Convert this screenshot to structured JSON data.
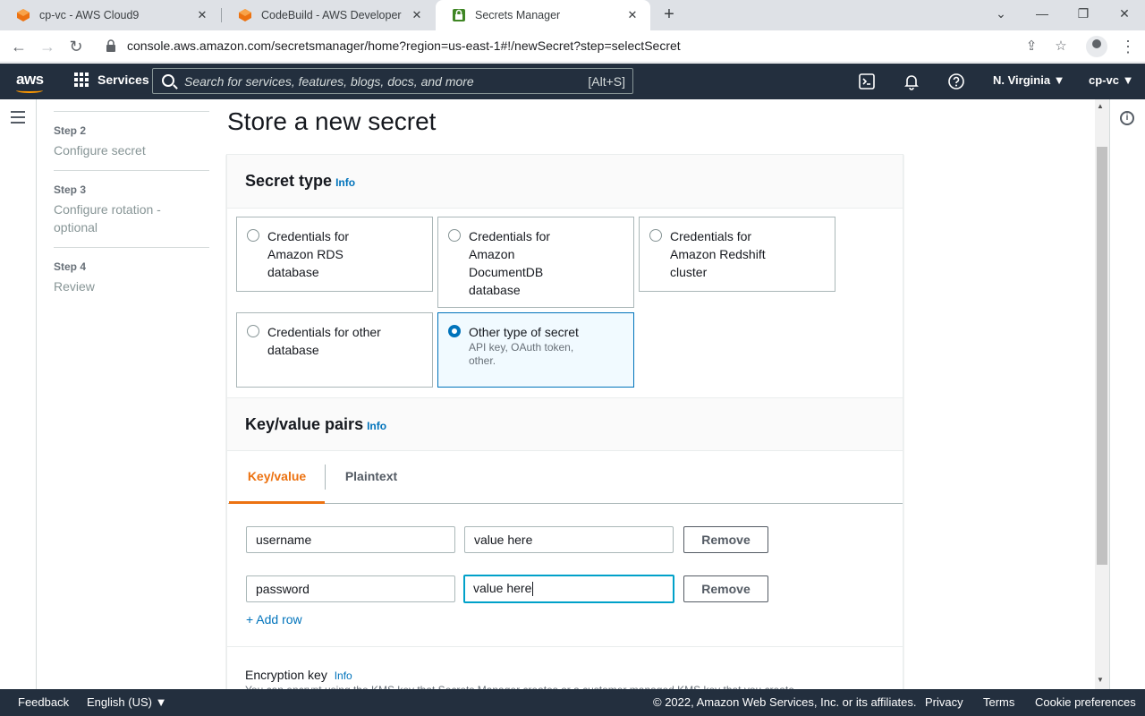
{
  "browser": {
    "tabs": [
      {
        "title": "cp-vc - AWS Cloud9",
        "active": false
      },
      {
        "title": "CodeBuild - AWS Developer Tools",
        "active": false
      },
      {
        "title": "Secrets Manager",
        "active": true
      }
    ],
    "url": "console.aws.amazon.com/secretsmanager/home?region=us-east-1#!/newSecret?step=selectSecret"
  },
  "aws_nav": {
    "logo": "aws",
    "services_label": "Services",
    "search_placeholder": "Search for services, features, blogs, docs, and more",
    "search_shortcut": "[Alt+S]",
    "region": "N. Virginia ▼",
    "account": "cp-vc ▼"
  },
  "steps": [
    {
      "number": "Step 2",
      "name": "Configure secret"
    },
    {
      "number": "Step 3",
      "name": "Configure rotation - optional"
    },
    {
      "number": "Step 4",
      "name": "Review"
    }
  ],
  "page_title": "Store a new secret",
  "secret_type": {
    "heading": "Secret type",
    "info": "Info",
    "options": [
      {
        "label": "Credentials for Amazon RDS database",
        "selected": false
      },
      {
        "label": "Credentials for Amazon DocumentDB database",
        "selected": false
      },
      {
        "label": "Credentials for Amazon Redshift cluster",
        "selected": false
      },
      {
        "label": "Credentials for other database",
        "selected": false
      },
      {
        "label": "Other type of secret",
        "description": "API key, OAuth token, other.",
        "selected": true
      }
    ]
  },
  "kv": {
    "heading": "Key/value pairs",
    "info": "Info",
    "tabs": [
      "Key/value",
      "Plaintext"
    ],
    "rows": [
      {
        "key": "username",
        "value": "value here",
        "remove": "Remove"
      },
      {
        "key": "password",
        "value": "value here",
        "remove": "Remove"
      }
    ],
    "add_row": "+ Add row"
  },
  "encryption": {
    "label": "Encryption key",
    "info": "Info",
    "desc": "You can encrypt using the KMS key that Secrets Manager creates or a customer managed KMS key that you create."
  },
  "footer": {
    "feedback": "Feedback",
    "language": "English (US) ▼",
    "copyright": "© 2022, Amazon Web Services, Inc. or its affiliates.",
    "privacy": "Privacy",
    "terms": "Terms",
    "cookies": "Cookie preferences"
  },
  "colors": {
    "aws_nav": "#232f3e",
    "accent_orange": "#ec7211",
    "link_blue": "#0073bb"
  }
}
